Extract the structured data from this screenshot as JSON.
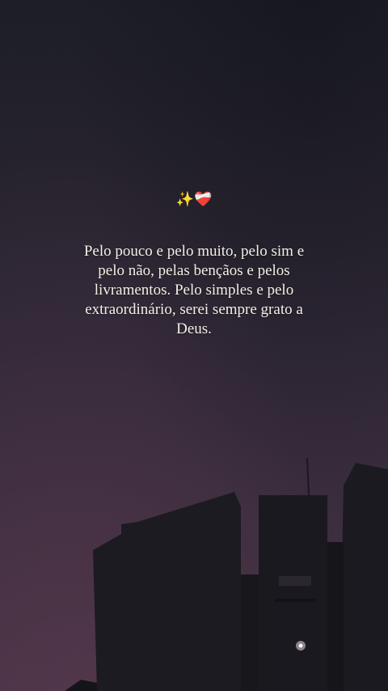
{
  "story": {
    "emojis": {
      "sparkles": "✨",
      "heart": "❤️‍🩹"
    },
    "quote": "Pelo pouco e pelo muito, pelo sim e pelo não, pelas bençãos e pelos livramentos. Pelo simples e pelo extraordinário, serei sempre grato a Deus."
  },
  "colors": {
    "text": "#f4efe6",
    "sky_top": "#1d1e26",
    "sky_bottom": "#473244",
    "silhouette": "#1b1a20"
  }
}
